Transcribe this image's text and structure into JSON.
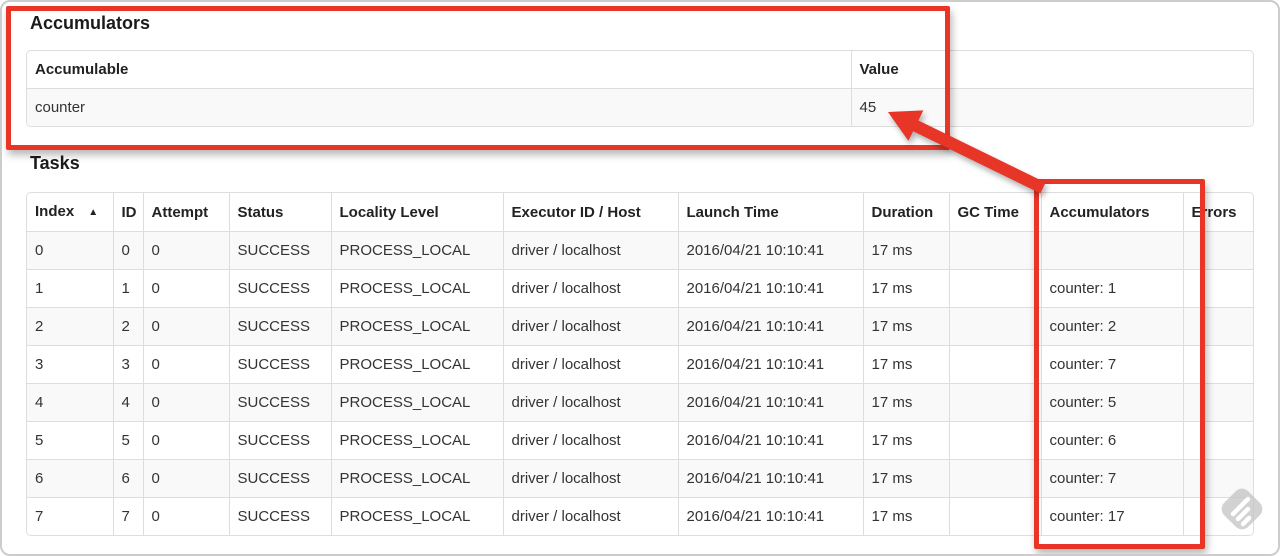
{
  "accumulators_section": {
    "title": "Accumulators",
    "table": {
      "sortable": false,
      "headers": [
        {
          "label": "Accumulable"
        },
        {
          "label": "Value"
        }
      ],
      "rows": [
        [
          "counter",
          "45"
        ]
      ]
    }
  },
  "tasks_section": {
    "title": "Tasks",
    "table": {
      "sortable": true,
      "sorted_column": "Index",
      "sort_direction": "ascending",
      "headers": [
        {
          "label": "Index",
          "sort_indicator": "▲"
        },
        {
          "label": "ID"
        },
        {
          "label": "Attempt"
        },
        {
          "label": "Status"
        },
        {
          "label": "Locality Level"
        },
        {
          "label": "Executor ID / Host"
        },
        {
          "label": "Launch Time"
        },
        {
          "label": "Duration"
        },
        {
          "label": "GC Time"
        },
        {
          "label": "Accumulators"
        },
        {
          "label": "Errors"
        }
      ],
      "rows": [
        [
          "0",
          "0",
          "0",
          "SUCCESS",
          "PROCESS_LOCAL",
          "driver / localhost",
          "2016/04/21 10:10:41",
          "17 ms",
          "",
          "",
          ""
        ],
        [
          "1",
          "1",
          "0",
          "SUCCESS",
          "PROCESS_LOCAL",
          "driver / localhost",
          "2016/04/21 10:10:41",
          "17 ms",
          "",
          "counter: 1",
          ""
        ],
        [
          "2",
          "2",
          "0",
          "SUCCESS",
          "PROCESS_LOCAL",
          "driver / localhost",
          "2016/04/21 10:10:41",
          "17 ms",
          "",
          "counter: 2",
          ""
        ],
        [
          "3",
          "3",
          "0",
          "SUCCESS",
          "PROCESS_LOCAL",
          "driver / localhost",
          "2016/04/21 10:10:41",
          "17 ms",
          "",
          "counter: 7",
          ""
        ],
        [
          "4",
          "4",
          "0",
          "SUCCESS",
          "PROCESS_LOCAL",
          "driver / localhost",
          "2016/04/21 10:10:41",
          "17 ms",
          "",
          "counter: 5",
          ""
        ],
        [
          "5",
          "5",
          "0",
          "SUCCESS",
          "PROCESS_LOCAL",
          "driver / localhost",
          "2016/04/21 10:10:41",
          "17 ms",
          "",
          "counter: 6",
          ""
        ],
        [
          "6",
          "6",
          "0",
          "SUCCESS",
          "PROCESS_LOCAL",
          "driver / localhost",
          "2016/04/21 10:10:41",
          "17 ms",
          "",
          "counter: 7",
          ""
        ],
        [
          "7",
          "7",
          "0",
          "SUCCESS",
          "PROCESS_LOCAL",
          "driver / localhost",
          "2016/04/21 10:10:41",
          "17 ms",
          "",
          "counter: 17",
          ""
        ]
      ]
    }
  },
  "annotations": {
    "color": "#e73527",
    "top_box_target": "accumulator value table",
    "column_box_target": "Accumulators column",
    "arrow_target": "value 45"
  },
  "watermark": {
    "icon": "feedly-watermark-icon",
    "color": "#c7c7c7"
  }
}
